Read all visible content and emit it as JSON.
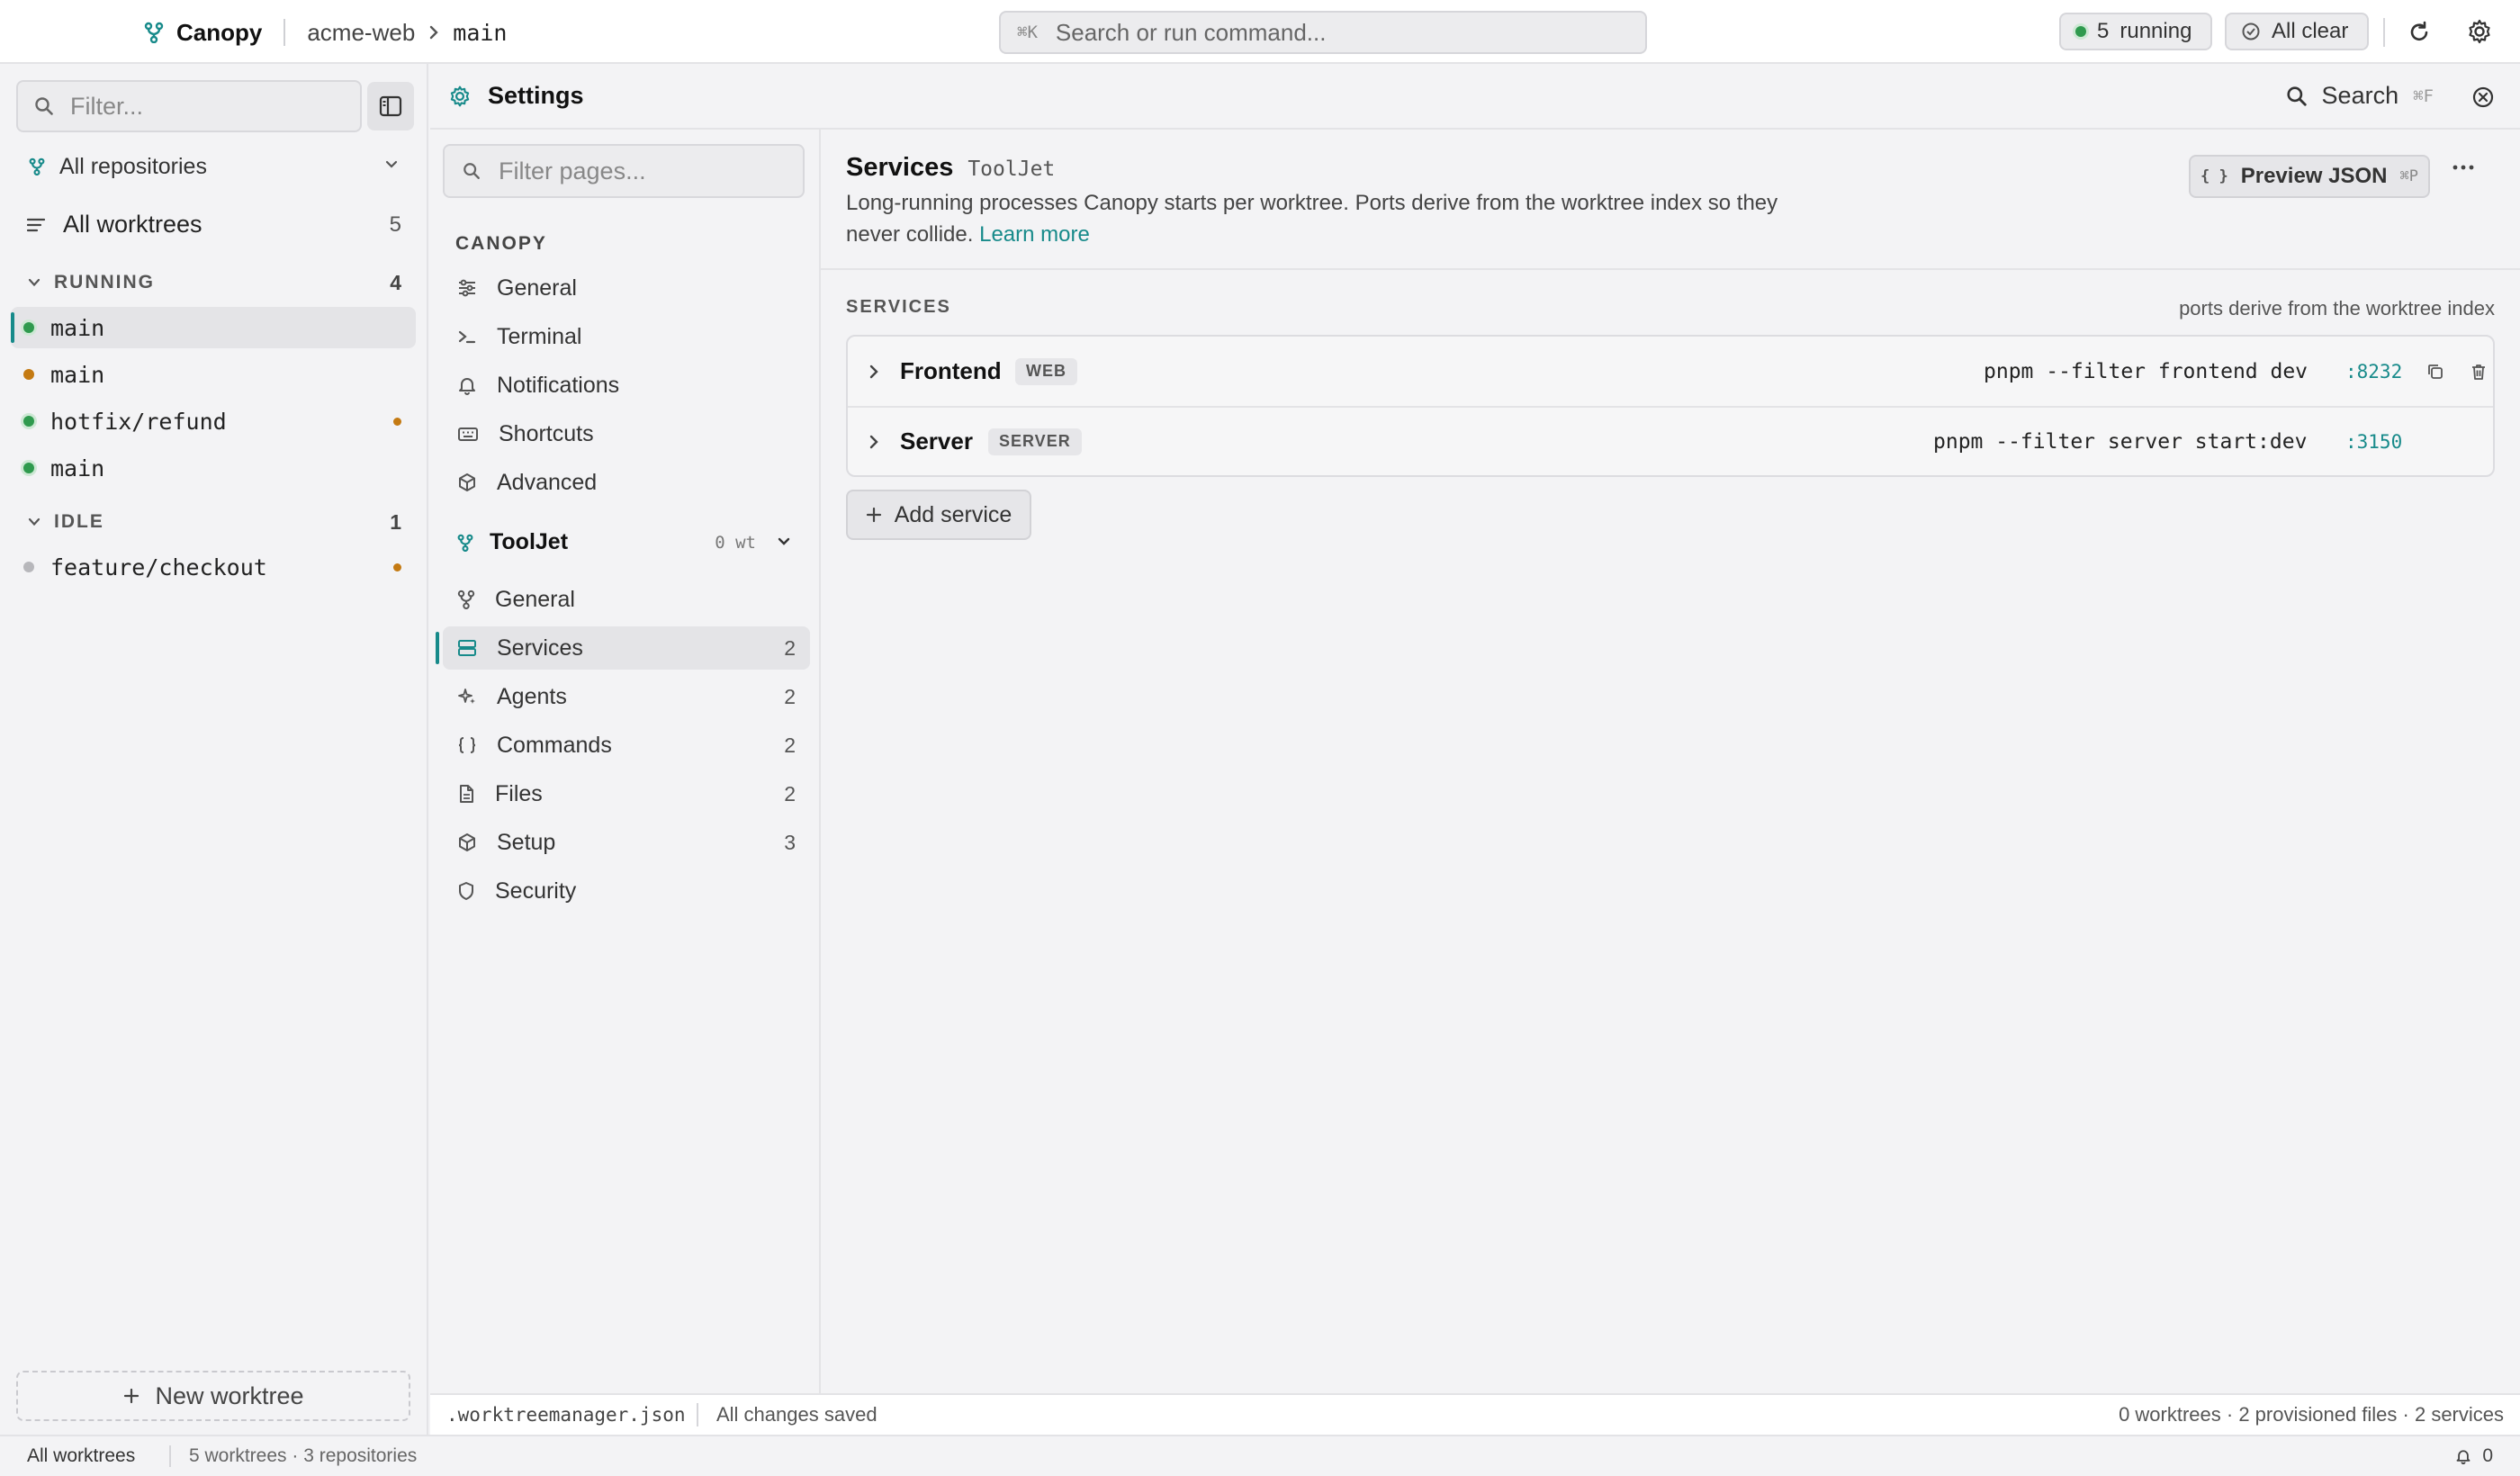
{
  "topbar": {
    "app_name": "Canopy",
    "repo": "acme-web",
    "branch": "main",
    "command": {
      "shortcut": "⌘K",
      "placeholder": "Search or run command..."
    },
    "running": {
      "count": "5",
      "label": "running"
    },
    "alerts": "All clear",
    "icons": [
      "branch-icon",
      "chevron-right-icon",
      "refresh-icon",
      "gear-icon"
    ]
  },
  "sidebar": {
    "filter_placeholder": "Filter...",
    "repo_select": "All repositories",
    "all_worktrees": {
      "label": "All worktrees",
      "count": "5"
    },
    "groups": [
      {
        "label": "RUNNING",
        "count": "4",
        "items": [
          {
            "name": "main",
            "status": "green",
            "active": true
          },
          {
            "name": "main",
            "status": "orange"
          },
          {
            "name": "hotfix/refund",
            "status": "green",
            "changes": true
          },
          {
            "name": "main",
            "status": "green"
          }
        ]
      },
      {
        "label": "IDLE",
        "count": "1",
        "items": [
          {
            "name": "feature/checkout",
            "status": "gray",
            "changes": true
          }
        ]
      }
    ],
    "new_worktree": "New worktree"
  },
  "settings": {
    "title": "Settings",
    "search_label": "Search",
    "search_shortcut": "⌘F",
    "nav": {
      "filter_placeholder": "Filter pages...",
      "section": "CANOPY",
      "global_items": [
        {
          "label": "General",
          "icon": "sliders-icon"
        },
        {
          "label": "Terminal",
          "icon": "terminal-icon"
        },
        {
          "label": "Notifications",
          "icon": "bell-icon"
        },
        {
          "label": "Shortcuts",
          "icon": "keyboard-icon"
        },
        {
          "label": "Advanced",
          "icon": "cube-icon"
        }
      ],
      "repo": {
        "name": "ToolJet",
        "worktrees": "0 wt"
      },
      "repo_items": [
        {
          "label": "General",
          "icon": "branch-icon",
          "count": ""
        },
        {
          "label": "Services",
          "icon": "server-icon",
          "count": "2",
          "active": true
        },
        {
          "label": "Agents",
          "icon": "sparkle-icon",
          "count": "2"
        },
        {
          "label": "Commands",
          "icon": "braces-icon",
          "count": "2"
        },
        {
          "label": "Files",
          "icon": "file-icon",
          "count": "2"
        },
        {
          "label": "Setup",
          "icon": "cube-icon",
          "count": "3"
        },
        {
          "label": "Security",
          "icon": "shield-icon",
          "count": ""
        }
      ]
    }
  },
  "main": {
    "title": "Services",
    "repo": "ToolJet",
    "description": "Long-running processes Canopy starts per worktree. Ports derive from the worktree index so they never collide.",
    "learn_more": "Learn more",
    "preview_json": {
      "label": "Preview JSON",
      "shortcut": "⌘P"
    },
    "section_label": "SERVICES",
    "section_note": "ports derive from the worktree index",
    "services": [
      {
        "name": "Frontend",
        "badge": "WEB",
        "command": "pnpm --filter frontend dev",
        "port": ":8232"
      },
      {
        "name": "Server",
        "badge": "SERVER",
        "command": "pnpm --filter server start:dev",
        "port": ":3150"
      }
    ],
    "add_service": "Add service"
  },
  "footer": {
    "file": ".worktreemanager.json",
    "saved": "All changes saved",
    "stats": "0 worktrees · 2 provisioned files · 2 services"
  },
  "statusbar": {
    "scope": "All worktrees",
    "summary": "5 worktrees · 3 repositories",
    "notifications": "0"
  },
  "colors": {
    "accent": "#178a8a",
    "running": "#2f9a4e",
    "changes": "#c47a12",
    "idle": "#b7b7bb"
  }
}
